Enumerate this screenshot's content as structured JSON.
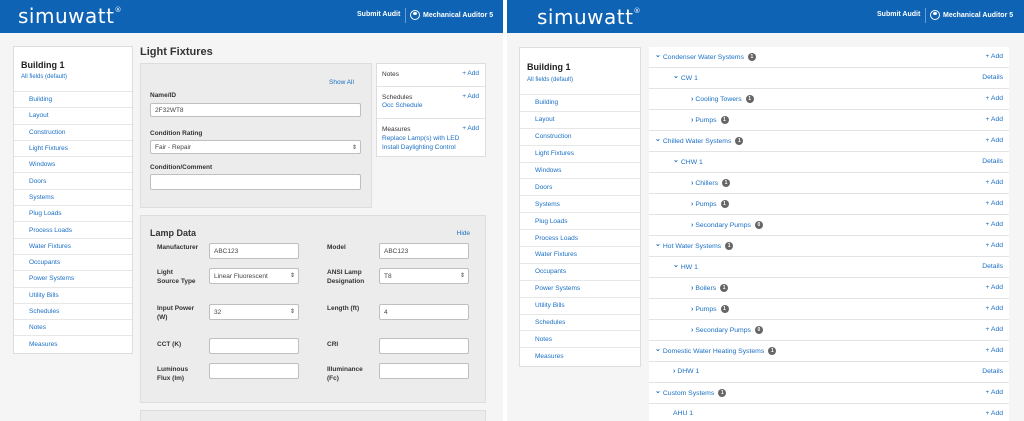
{
  "app": {
    "logo": "simuwatt",
    "submit_audit": "Submit Audit",
    "user": "Mechanical Auditor 5"
  },
  "colors": {
    "topbar": "#0f63b5",
    "link": "#1a6fc4",
    "badge": "#666666"
  },
  "sidebar": {
    "title": "Building 1",
    "subtitle": "All fields (default)",
    "items": [
      "Building",
      "Layout",
      "Construction",
      "Light Fixtures",
      "Windows",
      "Doors",
      "Systems",
      "Plug Loads",
      "Process Loads",
      "Water Fixtures",
      "Occupants",
      "Power Systems",
      "Utility Bills",
      "Schedules",
      "Notes",
      "Measures"
    ]
  },
  "left": {
    "page_title": "Light Fixtures",
    "show_all": "Show All",
    "name_label": "Name/ID",
    "name_value": "2F32WT8",
    "condition_label": "Condition Rating",
    "condition_value": "Fair - Repair",
    "comment_label": "Condition/Comment",
    "notes_label": "Notes",
    "add": "+ Add",
    "schedules_label": "Schedules",
    "schedule_link": "Occ Schedule",
    "measures_label": "Measures",
    "measure_1": "Replace Lamp(s) with LED",
    "measure_2": "Install Daylighting Control",
    "lamp_title": "Lamp Data",
    "hide": "Hide",
    "manufacturer_label": "Manufacturer",
    "manufacturer_value": "ABC123",
    "model_label": "Model",
    "model_value": "ABC123",
    "light_source_label_1": "Light",
    "light_source_label_2": "Source Type",
    "light_source_value": "Linear Fluorescent",
    "ansi_label_1": "ANSI Lamp",
    "ansi_label_2": "Designation",
    "ansi_value": "T8",
    "input_power_label_1": "Input Power",
    "input_power_label_2": "(W)",
    "input_power_value": "32",
    "length_label": "Length (ft)",
    "length_value": "4",
    "cct_label": "CCT (K)",
    "cri_label": "CRI",
    "lum_flux_label_1": "Luminous",
    "lum_flux_label_2": "Flux (lm)",
    "illum_label_1": "Illuminance",
    "illum_label_2": "(Fc)"
  },
  "tree": {
    "add": "+ Add",
    "details": "Details",
    "rows": [
      {
        "label": "Condenser Water Systems",
        "badge": "1",
        "level": 0,
        "expanded": true,
        "action": "add"
      },
      {
        "label": "CW 1",
        "badge": "",
        "level": 1,
        "expanded": true,
        "action": "details"
      },
      {
        "label": "Cooling Towers",
        "badge": "1",
        "level": 2,
        "expanded": false,
        "action": "add"
      },
      {
        "label": "Pumps",
        "badge": "1",
        "level": 2,
        "expanded": false,
        "action": "add"
      },
      {
        "label": "Chilled Water Systems",
        "badge": "1",
        "level": 0,
        "expanded": true,
        "action": "add"
      },
      {
        "label": "CHW 1",
        "badge": "",
        "level": 1,
        "expanded": true,
        "action": "details"
      },
      {
        "label": "Chillers",
        "badge": "1",
        "level": 2,
        "expanded": false,
        "action": "add"
      },
      {
        "label": "Pumps",
        "badge": "1",
        "level": 2,
        "expanded": false,
        "action": "add"
      },
      {
        "label": "Secondary Pumps",
        "badge": "0",
        "level": 2,
        "expanded": false,
        "action": "add"
      },
      {
        "label": "Hot Water Systems",
        "badge": "1",
        "level": 0,
        "expanded": true,
        "action": "add"
      },
      {
        "label": "HW 1",
        "badge": "",
        "level": 1,
        "expanded": true,
        "action": "details"
      },
      {
        "label": "Boilers",
        "badge": "1",
        "level": 2,
        "expanded": false,
        "action": "add"
      },
      {
        "label": "Pumps",
        "badge": "1",
        "level": 2,
        "expanded": false,
        "action": "add"
      },
      {
        "label": "Secondary Pumps",
        "badge": "0",
        "level": 2,
        "expanded": false,
        "action": "add"
      },
      {
        "label": "Domestic Water Heating Systems",
        "badge": "1",
        "level": 0,
        "expanded": true,
        "action": "add"
      },
      {
        "label": "DHW 1",
        "badge": "",
        "level": 1,
        "expanded": false,
        "action": "details"
      },
      {
        "label": "Custom Systems",
        "badge": "1",
        "level": 0,
        "expanded": true,
        "action": "add"
      },
      {
        "label": "AHU 1",
        "badge": "",
        "level": 1,
        "expanded": null,
        "action": "add"
      }
    ]
  }
}
